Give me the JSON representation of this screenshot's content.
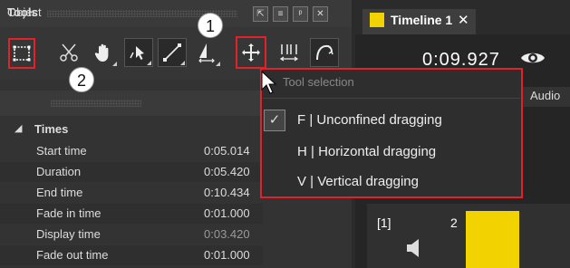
{
  "tools_panel": {
    "title": "Tools",
    "buttons": [
      "⇱",
      "≡",
      "ᵖ",
      "✕"
    ]
  },
  "object_panel": {
    "title": "Object",
    "group": "Times",
    "properties": [
      {
        "key": "Start time",
        "value": "0:05.014"
      },
      {
        "key": "Duration",
        "value": "0:05.420"
      },
      {
        "key": "End time",
        "value": "0:10.434"
      },
      {
        "key": "Fade in time",
        "value": "0:01.000"
      },
      {
        "key": "Display time",
        "value": "0:03.420"
      },
      {
        "key": "Fade out time",
        "value": "0:01.000"
      }
    ]
  },
  "timeline": {
    "tab_label": "Timeline 1",
    "tab_close": "✕",
    "time": "0:09.927",
    "audio_header": "Audio",
    "track_index": "[1]",
    "track_number": "2",
    "clip_color": "#f2d200"
  },
  "dropdown": {
    "title": "Tool selection",
    "check": "✓",
    "items": [
      {
        "label": "F  |  Unconfined dragging",
        "checked": true
      },
      {
        "label": "H  |  Horizontal dragging",
        "checked": false
      },
      {
        "label": "V  |  Vertical dragging",
        "checked": false
      }
    ]
  },
  "callouts": [
    "1",
    "2"
  ],
  "colors": {
    "accent": "#e3212b",
    "clip": "#f2d200"
  }
}
